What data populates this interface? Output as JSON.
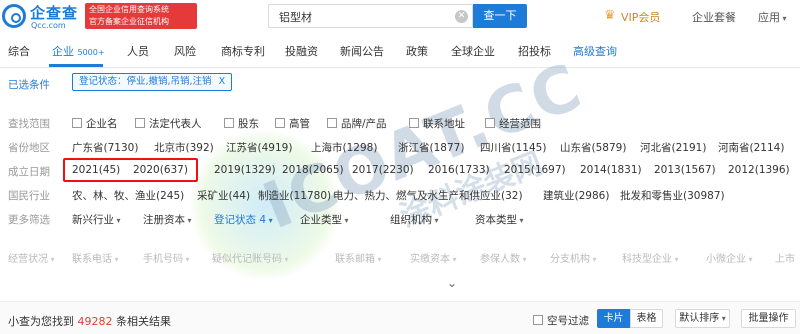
{
  "header": {
    "logo_cn": "企查查",
    "logo_en": "Qcc.com",
    "slogan_line1": "全国企业信用查询系统",
    "slogan_line2": "官方备案企业征信机构",
    "search_value": "铝型材",
    "search_button": "查一下",
    "vip_label": "VIP会员",
    "package_label": "企业套餐",
    "app_label": "应用",
    "accent": "#1f7bd8",
    "brand_red": "#e63a3a"
  },
  "tabs": [
    {
      "label": "综合"
    },
    {
      "label": "企业",
      "badge": "5000+"
    },
    {
      "label": "人员"
    },
    {
      "label": "风险"
    },
    {
      "label": "商标专利"
    },
    {
      "label": "投融资"
    },
    {
      "label": "新闻公告"
    },
    {
      "label": "政策"
    },
    {
      "label": "全球企业"
    },
    {
      "label": "招投标"
    },
    {
      "label": "高级查询"
    }
  ],
  "selected": {
    "label": "已选条件",
    "tag": "登记状态：停业,撤销,吊销,注销",
    "tag_close": "X"
  },
  "filters": {
    "scope": {
      "label": "查找范围",
      "options": [
        "企业名",
        "法定代表人",
        "股东",
        "高管",
        "品牌/产品",
        "联系地址",
        "经营范围"
      ]
    },
    "region": {
      "label": "省份地区",
      "options": [
        "广东省(7130)",
        "北京市(392)",
        "江苏省(4919)",
        "上海市(1298)",
        "浙江省(1877)",
        "四川省(1145)",
        "山东省(5879)",
        "河北省(2191)",
        "河南省(2114)"
      ]
    },
    "founded": {
      "label": "成立日期",
      "options": [
        "2021(45)",
        "2020(637)",
        "2019(1329)",
        "2018(2065)",
        "2017(2230)",
        "2016(1733)",
        "2015(1697)",
        "2014(1831)",
        "2013(1567)",
        "2012(1396)"
      ]
    },
    "industry": {
      "label": "国民行业",
      "options": [
        "农、林、牧、渔业(245)",
        "采矿业(44)",
        "制造业(11780)",
        "电力、热力、燃气及水生产和供应业(32)",
        "建筑业(2986)",
        "批发和零售业(30987)"
      ]
    },
    "more": {
      "label": "更多筛选",
      "options": [
        "新兴行业",
        "注册资本",
        "登记状态 4",
        "企业类型",
        "组织机构",
        "资本类型"
      ]
    },
    "hidden_row": {
      "options": [
        "经营状况",
        "联系电话",
        "手机号码",
        "疑似代记账号码",
        "联系邮箱",
        "实缴资本",
        "参保人数",
        "分支机构",
        "科技型企业",
        "小微企业",
        "上市"
      ]
    }
  },
  "results": {
    "prefix": "小查为您找到",
    "count": "49282",
    "suffix": "条相关结果",
    "empty_filter": "空号过滤",
    "card_view": "卡片",
    "table_view": "表格",
    "sort": "默认排序",
    "batch": "批量操作"
  },
  "watermark": {
    "text": "ICOAT.CC",
    "cn": "涂料涂装网"
  }
}
